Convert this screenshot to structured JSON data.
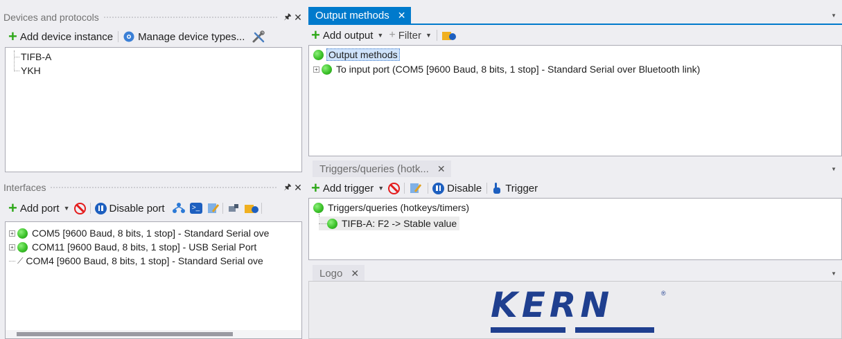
{
  "devices_panel": {
    "title": "Devices and protocols",
    "pin": "1",
    "close": "×",
    "toolbar": {
      "add_device_instance": "Add device instance",
      "manage_device_types": "Manage device types..."
    },
    "items": [
      "TIFB-A",
      "YKH"
    ]
  },
  "interfaces_panel": {
    "title": "Interfaces",
    "toolbar": {
      "add_port": "Add port",
      "disable_port": "Disable port"
    },
    "items": [
      "COM5 [9600 Baud, 8 bits, 1 stop] - Standard Serial ove",
      "COM11 [9600 Baud, 8 bits, 1 stop] - USB Serial Port",
      "COM4 [9600 Baud, 8 bits, 1 stop] - Standard Serial ove"
    ]
  },
  "output_panel": {
    "tab": "Output methods",
    "toolbar": {
      "add_output": "Add output",
      "filter": "Filter"
    },
    "root": "Output methods",
    "child": "To input port (COM5 [9600 Baud, 8 bits, 1 stop] - Standard Serial over Bluetooth link)"
  },
  "triggers_panel": {
    "tab": "Triggers/queries (hotk...",
    "toolbar": {
      "add_trigger": "Add trigger",
      "disable": "Disable",
      "trigger": "Trigger"
    },
    "root": "Triggers/queries (hotkeys/timers)",
    "child": "TIFB-A: F2 -> Stable value"
  },
  "logo_panel": {
    "tab": "Logo",
    "brand": "KERN",
    "brand_color": "#1f3f8f"
  },
  "colors": {
    "accent": "#007acc",
    "status_green": "#3cc22a",
    "stop_red": "#e41c1c"
  }
}
